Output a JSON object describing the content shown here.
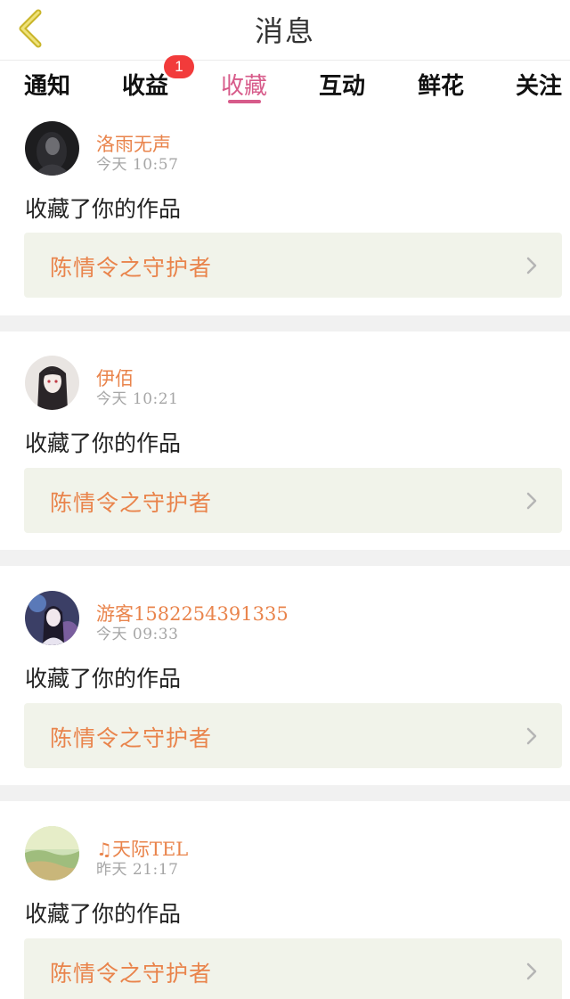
{
  "header": {
    "title": "消息",
    "back_icon": "chevron-left-icon",
    "back_color": "#d4c23a"
  },
  "tabs": [
    {
      "label": "通知",
      "active": false
    },
    {
      "label": "收益",
      "active": false,
      "badge": "1"
    },
    {
      "label": "收藏",
      "active": true
    },
    {
      "label": "互动",
      "active": false
    },
    {
      "label": "鲜花",
      "active": false
    },
    {
      "label": "关注",
      "active": false
    }
  ],
  "colors": {
    "accent": "#d75b8a",
    "username": "#e9844c",
    "badge": "#f23b3b",
    "work_box_bg": "#f1f3ea"
  },
  "messages": [
    {
      "user": "洛雨无声",
      "time": "今天  10:57",
      "action": "收藏了你的作品",
      "work": "陈情令之守护者"
    },
    {
      "user": "伊佰",
      "time": "今天  10:21",
      "action": "收藏了你的作品",
      "work": "陈情令之守护者"
    },
    {
      "user": "游客1582254391335",
      "time": "今天  09:33",
      "action": "收藏了你的作品",
      "work": "陈情令之守护者"
    },
    {
      "user": "天际TEL",
      "user_prefix_icon": "music-note-icon",
      "time": "昨天  21:17",
      "action": "收藏了你的作品",
      "work": "陈情令之守护者"
    }
  ]
}
